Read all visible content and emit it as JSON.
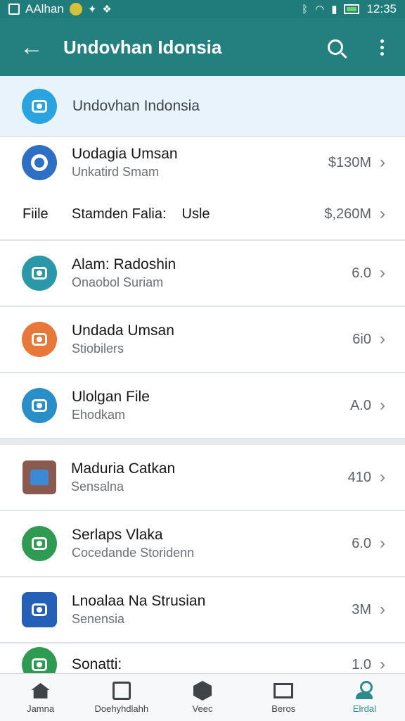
{
  "status_bar": {
    "left_text": "AAlhan",
    "time": "12:35"
  },
  "app_bar": {
    "title": "Undovhan Idonsia",
    "back_icon": "back-arrow-icon",
    "search_icon": "search-icon",
    "menu_icon": "more-vert-icon"
  },
  "header": {
    "label": "Undovhan Indonsia",
    "icon_color": "#2aa4e0"
  },
  "items": [
    {
      "title": "Uodagia Umsan",
      "subtitle": "Unkatird Smam",
      "value": "$130M",
      "icon_color": "#2d6fc4"
    },
    {
      "title": "Alam: Radoshin",
      "subtitle": "Onaobol Suriam",
      "value": "6.0",
      "icon_color": "#2a98a8"
    },
    {
      "title": "Undada Umsan",
      "subtitle": "Stiobilers",
      "value": "6i0",
      "icon_color": "#e8783a"
    },
    {
      "title": "Ulolgan File",
      "subtitle": "Ehodkam",
      "value": "A.0",
      "icon_color": "#2a8ec8"
    },
    {
      "title": "Maduria Catkan",
      "subtitle": "Sensalna",
      "value": "410",
      "icon_color": "#3a8ad6"
    },
    {
      "title": "Serlaps Vlaka",
      "subtitle": "Cocedande Storidenn",
      "value": "6.0",
      "icon_color": "#2f9a52"
    },
    {
      "title": "Lnoalaa Na Strusian",
      "subtitle": "Senensia",
      "value": "3M",
      "icon_color": "#2460b8"
    },
    {
      "title": "Sonatti:",
      "subtitle": "",
      "value": "1.0",
      "icon_color": "#2f9a52"
    }
  ],
  "file_row": {
    "label": "Fiile",
    "middle": "Stamden Falia:",
    "middle_suffix": "Usle",
    "value": "$,260M"
  },
  "bottom_nav": [
    {
      "label": "Jamna",
      "icon": "home-icon"
    },
    {
      "label": "Doehyhdlahh",
      "icon": "document-check-icon"
    },
    {
      "label": "Veec",
      "icon": "shield-icon"
    },
    {
      "label": "Beros",
      "icon": "mail-icon"
    },
    {
      "label": "Elrdal",
      "icon": "profile-icon"
    }
  ]
}
